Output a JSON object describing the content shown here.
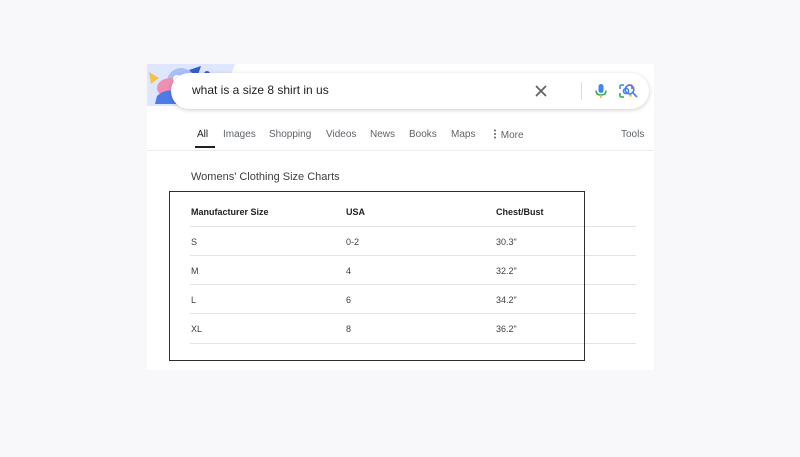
{
  "search": {
    "query": "what is a size 8 shirt in us"
  },
  "icons": {
    "clear": "close-icon",
    "voice": "microphone-icon",
    "lens": "camera-lens-icon",
    "search": "search-icon",
    "more": "vertical-dots-icon"
  },
  "colors": {
    "accent_blue": "#4285f4",
    "mic_red": "#ea4335",
    "mic_yellow": "#fbbc04",
    "mic_green": "#34a853",
    "text_dark": "#202124",
    "text_muted": "#5f6368"
  },
  "tabs": [
    {
      "label": "All",
      "active": true
    },
    {
      "label": "Images",
      "active": false
    },
    {
      "label": "Shopping",
      "active": false
    },
    {
      "label": "Videos",
      "active": false
    },
    {
      "label": "News",
      "active": false
    },
    {
      "label": "Books",
      "active": false
    },
    {
      "label": "Maps",
      "active": false
    },
    {
      "label": "More",
      "active": false
    }
  ],
  "tools_label": "Tools",
  "size_chart": {
    "title": "Womens' Clothing Size Charts",
    "headers": [
      "Manufacturer Size",
      "USA",
      "Chest/Bust"
    ],
    "rows": [
      [
        "S",
        "0-2",
        "30.3\""
      ],
      [
        "M",
        "4",
        "32.2\""
      ],
      [
        "L",
        "6",
        "34.2\""
      ],
      [
        "XL",
        "8",
        "36.2\""
      ]
    ]
  }
}
